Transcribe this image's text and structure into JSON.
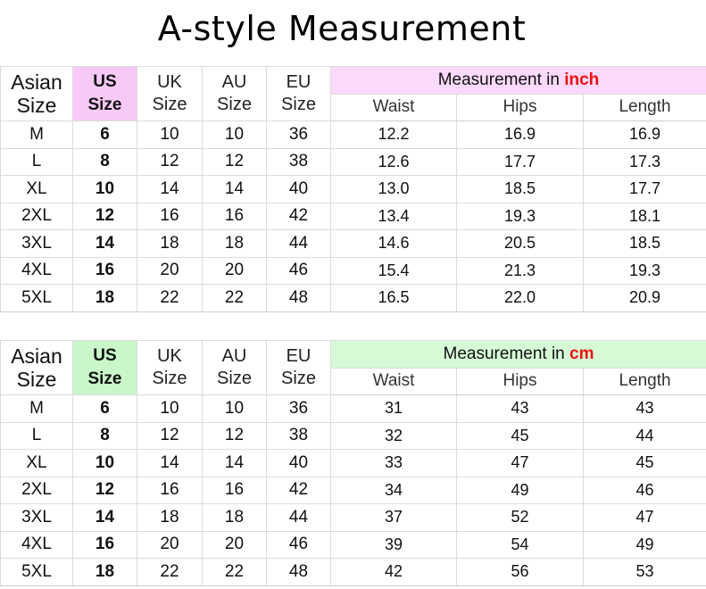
{
  "title": "A-style Measurement",
  "headers": {
    "asian_1": "Asian",
    "asian_2": "Size",
    "us_1": "US",
    "us_2": "Size",
    "uk_1": "UK",
    "uk_2": "Size",
    "au_1": "AU",
    "au_2": "Size",
    "eu_1": "EU",
    "eu_2": "Size",
    "waist": "Waist",
    "hips": "Hips",
    "length": "Length"
  },
  "inch_table": {
    "caption_prefix": "Measurement in ",
    "caption_unit": "inch",
    "accent": "#f7c9f7",
    "rows": [
      {
        "asian": "M",
        "us": "6",
        "uk": "10",
        "au": "10",
        "eu": "36",
        "waist": "12.2",
        "hips": "16.9",
        "length": "16.9"
      },
      {
        "asian": "L",
        "us": "8",
        "uk": "12",
        "au": "12",
        "eu": "38",
        "waist": "12.6",
        "hips": "17.7",
        "length": "17.3"
      },
      {
        "asian": "XL",
        "us": "10",
        "uk": "14",
        "au": "14",
        "eu": "40",
        "waist": "13.0",
        "hips": "18.5",
        "length": "17.7"
      },
      {
        "asian": "2XL",
        "us": "12",
        "uk": "16",
        "au": "16",
        "eu": "42",
        "waist": "13.4",
        "hips": "19.3",
        "length": "18.1"
      },
      {
        "asian": "3XL",
        "us": "14",
        "uk": "18",
        "au": "18",
        "eu": "44",
        "waist": "14.6",
        "hips": "20.5",
        "length": "18.5"
      },
      {
        "asian": "4XL",
        "us": "16",
        "uk": "20",
        "au": "20",
        "eu": "46",
        "waist": "15.4",
        "hips": "21.3",
        "length": "19.3"
      },
      {
        "asian": "5XL",
        "us": "18",
        "uk": "22",
        "au": "22",
        "eu": "48",
        "waist": "16.5",
        "hips": "22.0",
        "length": "20.9"
      }
    ]
  },
  "cm_table": {
    "caption_prefix": "Measurement in ",
    "caption_unit": "cm",
    "accent": "#c9f7c9",
    "rows": [
      {
        "asian": "M",
        "us": "6",
        "uk": "10",
        "au": "10",
        "eu": "36",
        "waist": "31",
        "hips": "43",
        "length": "43"
      },
      {
        "asian": "L",
        "us": "8",
        "uk": "12",
        "au": "12",
        "eu": "38",
        "waist": "32",
        "hips": "45",
        "length": "44"
      },
      {
        "asian": "XL",
        "us": "10",
        "uk": "14",
        "au": "14",
        "eu": "40",
        "waist": "33",
        "hips": "47",
        "length": "45"
      },
      {
        "asian": "2XL",
        "us": "12",
        "uk": "16",
        "au": "16",
        "eu": "42",
        "waist": "34",
        "hips": "49",
        "length": "46"
      },
      {
        "asian": "3XL",
        "us": "14",
        "uk": "18",
        "au": "18",
        "eu": "44",
        "waist": "37",
        "hips": "52",
        "length": "47"
      },
      {
        "asian": "4XL",
        "us": "16",
        "uk": "20",
        "au": "20",
        "eu": "46",
        "waist": "39",
        "hips": "54",
        "length": "49"
      },
      {
        "asian": "5XL",
        "us": "18",
        "uk": "22",
        "au": "22",
        "eu": "48",
        "waist": "42",
        "hips": "56",
        "length": "53"
      }
    ]
  }
}
